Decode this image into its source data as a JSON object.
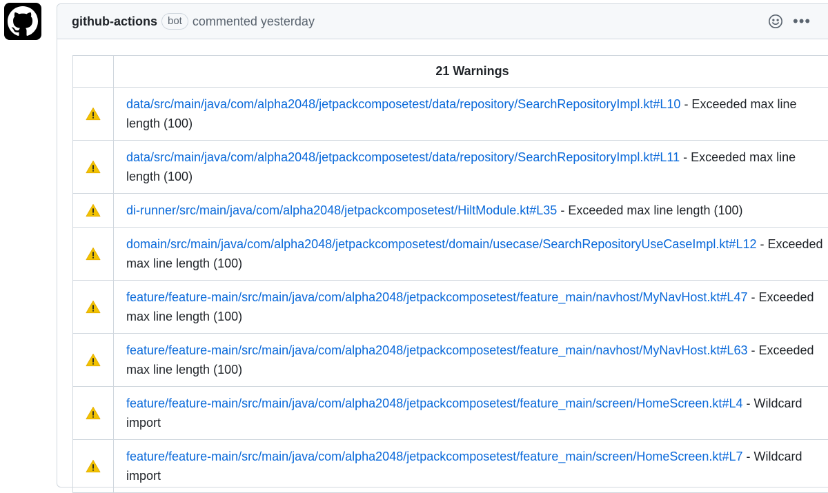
{
  "comment": {
    "author": "github-actions",
    "badge": "bot",
    "meta": "commented yesterday",
    "avatar_icon": "github-octocat-icon",
    "reaction_icon": "smiley-icon",
    "menu_icon": "kebab-icon"
  },
  "table": {
    "header": "21 Warnings",
    "warning_icon": "warning-icon",
    "rows": [
      {
        "link": "data/src/main/java/com/alpha2048/jetpackcomposetest/data/repository/SearchRepositoryImpl.kt#L10",
        "message": " - Exceeded max line length (100)"
      },
      {
        "link": "data/src/main/java/com/alpha2048/jetpackcomposetest/data/repository/SearchRepositoryImpl.kt#L11",
        "message": " - Exceeded max line length (100)"
      },
      {
        "link": "di-runner/src/main/java/com/alpha2048/jetpackcomposetest/HiltModule.kt#L35",
        "message": " - Exceeded max line length (100)"
      },
      {
        "link": "domain/src/main/java/com/alpha2048/jetpackcomposetest/domain/usecase/SearchRepositoryUseCaseImpl.kt#L12",
        "message": " - Exceeded max line length (100)"
      },
      {
        "link": "feature/feature-main/src/main/java/com/alpha2048/jetpackcomposetest/feature_main/navhost/MyNavHost.kt#L47",
        "message": " - Exceeded max line length (100)"
      },
      {
        "link": "feature/feature-main/src/main/java/com/alpha2048/jetpackcomposetest/feature_main/navhost/MyNavHost.kt#L63",
        "message": " - Exceeded max line length (100)"
      },
      {
        "link": "feature/feature-main/src/main/java/com/alpha2048/jetpackcomposetest/feature_main/screen/HomeScreen.kt#L4",
        "message": " - Wildcard import"
      },
      {
        "link": "feature/feature-main/src/main/java/com/alpha2048/jetpackcomposetest/feature_main/screen/HomeScreen.kt#L7",
        "message": " - Wildcard import"
      }
    ]
  },
  "colors": {
    "link": "#0969da",
    "warning": "#f2c200",
    "border": "#d0d7de"
  }
}
